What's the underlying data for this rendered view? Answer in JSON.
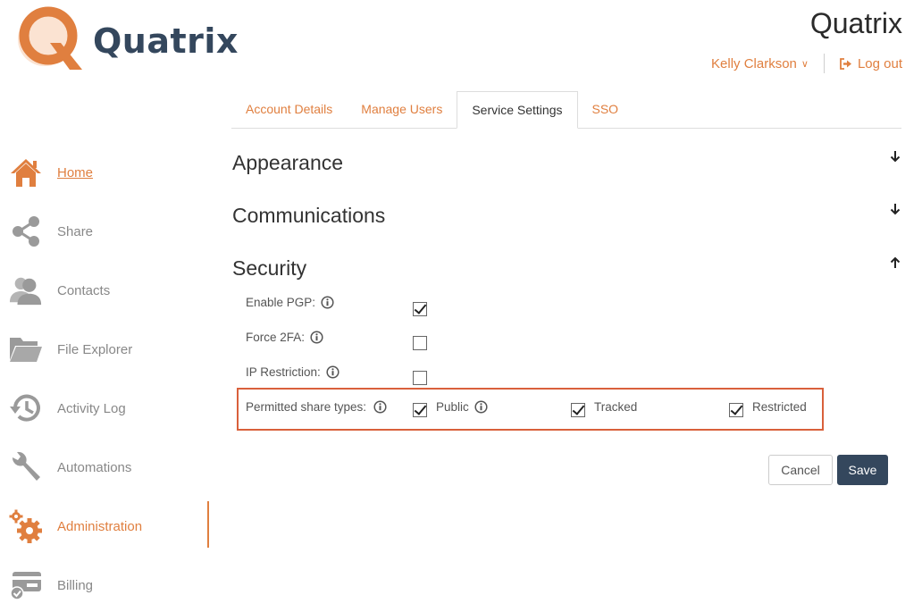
{
  "logo": {
    "text": "Quatrix"
  },
  "header": {
    "brand": "Quatrix",
    "user_name": "Kelly Clarkson",
    "logout_label": "Log out"
  },
  "tabs": [
    {
      "label": "Account Details",
      "active": false
    },
    {
      "label": "Manage Users",
      "active": false
    },
    {
      "label": "Service Settings",
      "active": true
    },
    {
      "label": "SSO",
      "active": false
    }
  ],
  "sidebar": {
    "items": [
      {
        "label": "Home",
        "icon": "home-icon"
      },
      {
        "label": "Share",
        "icon": "share-icon"
      },
      {
        "label": "Contacts",
        "icon": "contacts-icon"
      },
      {
        "label": "File Explorer",
        "icon": "folder-icon"
      },
      {
        "label": "Activity Log",
        "icon": "history-icon"
      },
      {
        "label": "Automations",
        "icon": "wrench-icon"
      },
      {
        "label": "Administration",
        "icon": "gears-icon"
      },
      {
        "label": "Billing",
        "icon": "billing-icon"
      }
    ]
  },
  "sections": {
    "appearance": "Appearance",
    "communications": "Communications",
    "security": "Security"
  },
  "security": {
    "enable_pgp": {
      "label": "Enable PGP:",
      "checked": true
    },
    "force_2fa": {
      "label": "Force 2FA:",
      "checked": false
    },
    "ip_restriction": {
      "label": "IP Restriction:",
      "checked": false
    },
    "share_types": {
      "label": "Permitted share types:",
      "public": {
        "label": "Public",
        "checked": true
      },
      "tracked": {
        "label": "Tracked",
        "checked": true
      },
      "restricted": {
        "label": "Restricted",
        "checked": true
      }
    }
  },
  "buttons": {
    "cancel": "Cancel",
    "save": "Save"
  },
  "colors": {
    "accent": "#e07f3f",
    "primary": "#34475d",
    "highlight": "#d9603b",
    "icon_gray": "#9a9a9a"
  }
}
